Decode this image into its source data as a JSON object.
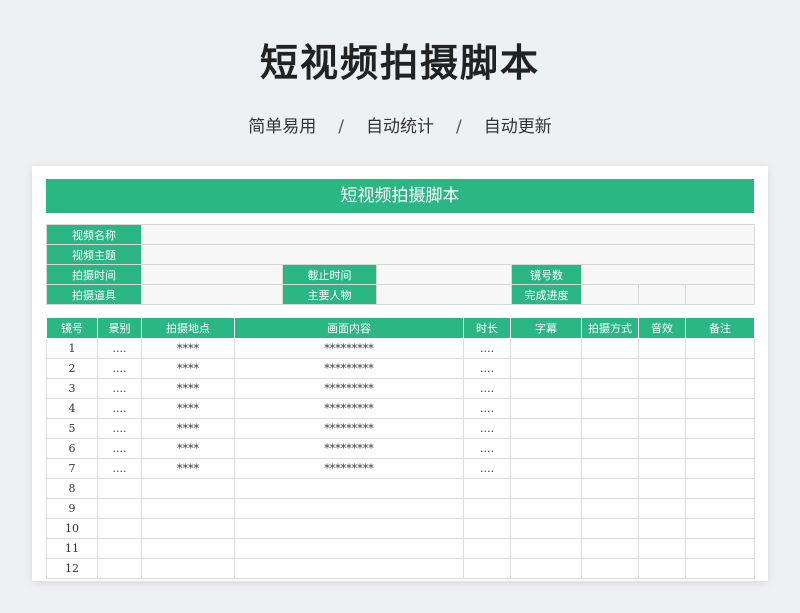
{
  "header": {
    "title": "短视频拍摄脚本",
    "subtitle": [
      "简单易用",
      "自动统计",
      "自动更新"
    ],
    "separator": "/"
  },
  "sheet": {
    "title": "短视频拍摄脚本",
    "info": {
      "video_name": "视频名称",
      "video_topic": "视频主题",
      "shoot_time": "拍摄时间",
      "deadline": "截止时间",
      "shot_count": "镜号数",
      "props": "拍摄道具",
      "main_characters": "主要人物",
      "progress": "完成进度"
    },
    "columns": [
      "镜号",
      "景别",
      "拍摄地点",
      "画面内容",
      "时长",
      "字幕",
      "拍摄方式",
      "音效",
      "备注"
    ],
    "rows": [
      [
        "1",
        "....",
        "****",
        "*********",
        "....",
        "",
        "",
        "",
        ""
      ],
      [
        "2",
        "....",
        "****",
        "*********",
        "....",
        "",
        "",
        "",
        ""
      ],
      [
        "3",
        "....",
        "****",
        "*********",
        "....",
        "",
        "",
        "",
        ""
      ],
      [
        "4",
        "....",
        "****",
        "*********",
        "....",
        "",
        "",
        "",
        ""
      ],
      [
        "5",
        "....",
        "****",
        "*********",
        "....",
        "",
        "",
        "",
        ""
      ],
      [
        "6",
        "....",
        "****",
        "*********",
        "....",
        "",
        "",
        "",
        ""
      ],
      [
        "7",
        "....",
        "****",
        "*********",
        "....",
        "",
        "",
        "",
        ""
      ],
      [
        "8",
        "",
        "",
        "",
        "",
        "",
        "",
        "",
        ""
      ],
      [
        "9",
        "",
        "",
        "",
        "",
        "",
        "",
        "",
        ""
      ],
      [
        "10",
        "",
        "",
        "",
        "",
        "",
        "",
        "",
        ""
      ],
      [
        "11",
        "",
        "",
        "",
        "",
        "",
        "",
        "",
        ""
      ],
      [
        "12",
        "",
        "",
        "",
        "",
        "",
        "",
        "",
        ""
      ]
    ],
    "colors": {
      "accent": "#2bb784"
    }
  }
}
